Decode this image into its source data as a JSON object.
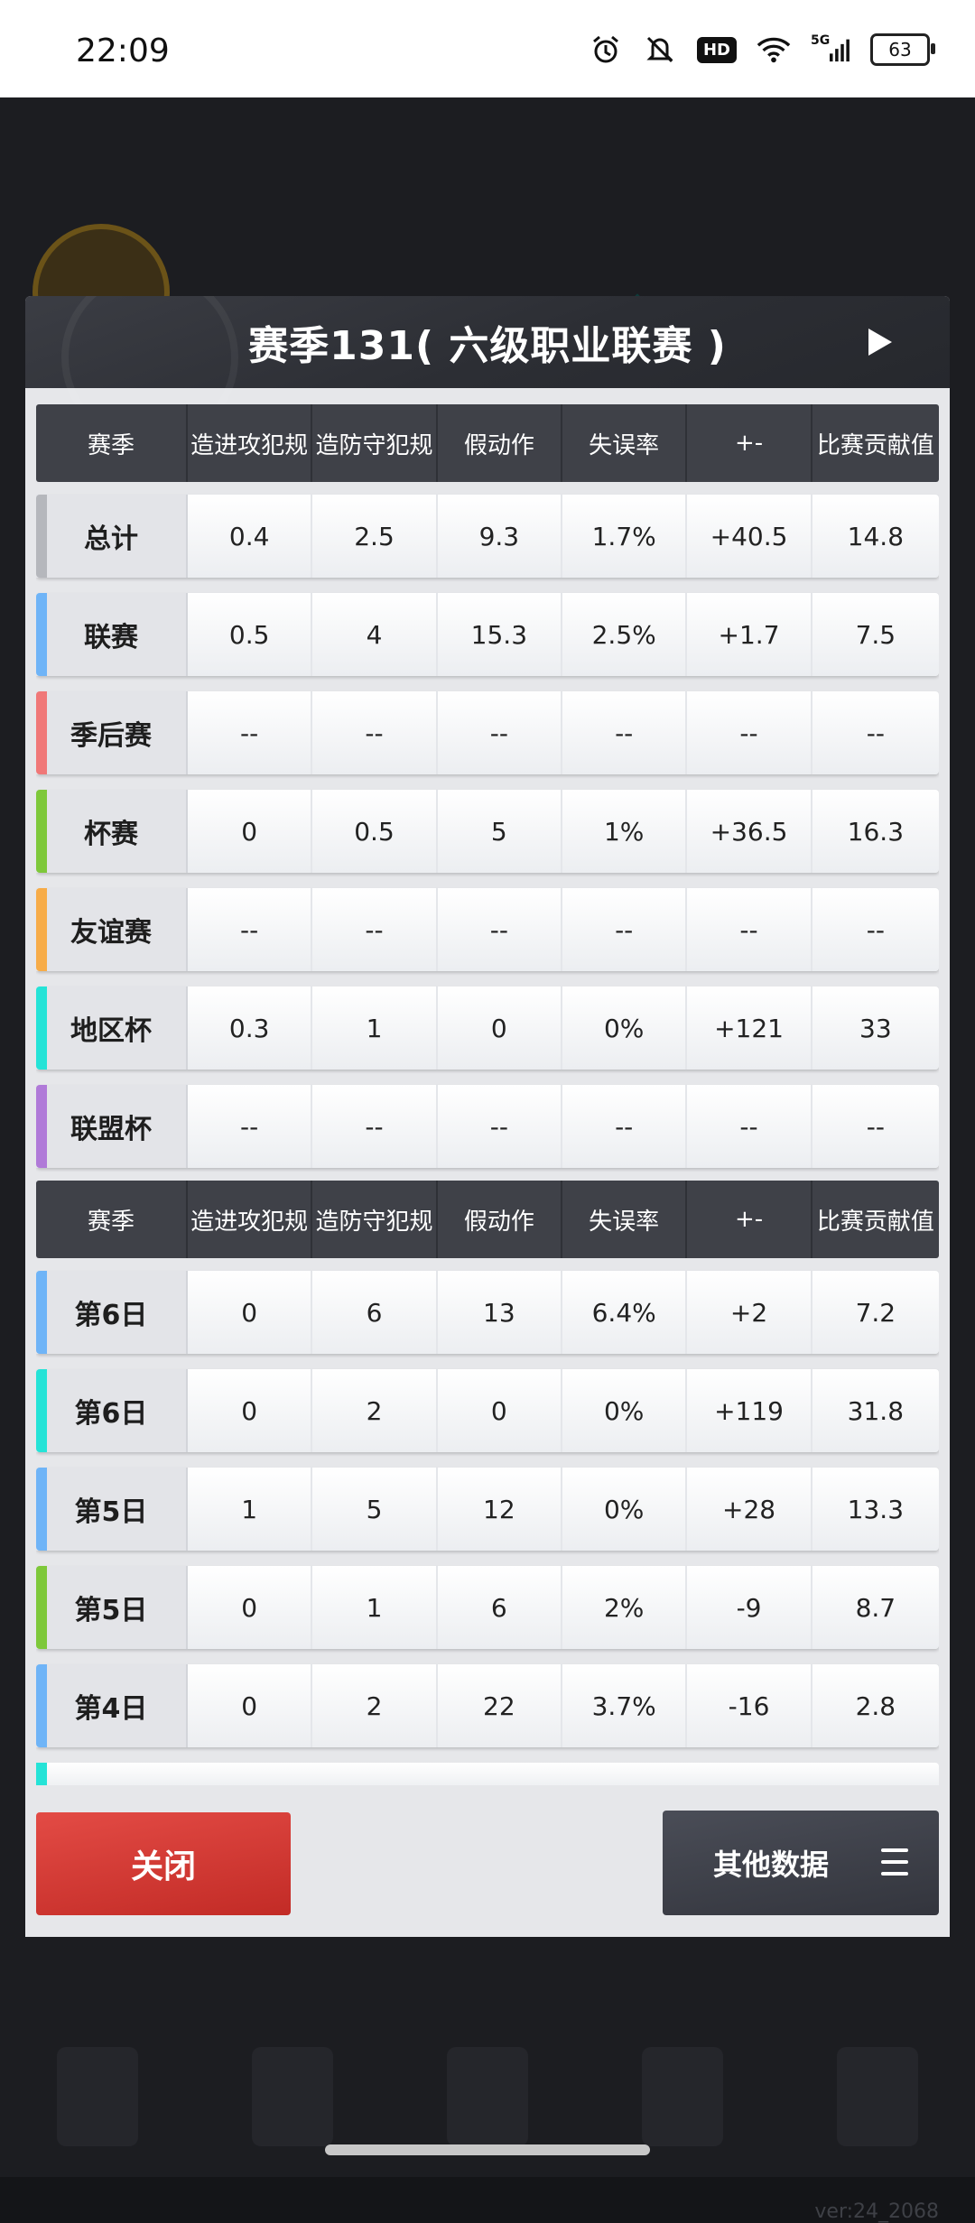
{
  "status_bar": {
    "time": "22:09",
    "hd": "HD",
    "network": "5G",
    "battery": "63"
  },
  "modal": {
    "title": "赛季131( 六级职业联赛 )"
  },
  "table1": {
    "headers": [
      "赛季",
      "造进攻犯规",
      "造防守犯规",
      "假动作",
      "失误率",
      "+-",
      "比赛贡献值"
    ],
    "rows": [
      {
        "label": "总计",
        "color": "#b5b7bc",
        "values": [
          "0.4",
          "2.5",
          "9.3",
          "1.7%",
          "+40.5",
          "14.8"
        ]
      },
      {
        "label": "联赛",
        "color": "#6fb4f7",
        "values": [
          "0.5",
          "4",
          "15.3",
          "2.5%",
          "+1.7",
          "7.5"
        ]
      },
      {
        "label": "季后赛",
        "color": "#f07878",
        "values": [
          "--",
          "--",
          "--",
          "--",
          "--",
          "--"
        ]
      },
      {
        "label": "杯赛",
        "color": "#7ec83a",
        "values": [
          "0",
          "0.5",
          "5",
          "1%",
          "+36.5",
          "16.3"
        ]
      },
      {
        "label": "友谊赛",
        "color": "#f7ac48",
        "values": [
          "--",
          "--",
          "--",
          "--",
          "--",
          "--"
        ]
      },
      {
        "label": "地区杯",
        "color": "#25e3d7",
        "values": [
          "0.3",
          "1",
          "0",
          "0%",
          "+121",
          "33"
        ]
      },
      {
        "label": "联盟杯",
        "color": "#b07ad8",
        "values": [
          "--",
          "--",
          "--",
          "--",
          "--",
          "--"
        ]
      }
    ]
  },
  "table2": {
    "headers": [
      "赛季",
      "造进攻犯规",
      "造防守犯规",
      "假动作",
      "失误率",
      "+-",
      "比赛贡献值"
    ],
    "rows": [
      {
        "label": "第6日",
        "color": "#6fb4f7",
        "values": [
          "0",
          "6",
          "13",
          "6.4%",
          "+2",
          "7.2"
        ]
      },
      {
        "label": "第6日",
        "color": "#25e3d7",
        "values": [
          "0",
          "2",
          "0",
          "0%",
          "+119",
          "31.8"
        ]
      },
      {
        "label": "第5日",
        "color": "#6fb4f7",
        "values": [
          "1",
          "5",
          "12",
          "0%",
          "+28",
          "13.3"
        ]
      },
      {
        "label": "第5日",
        "color": "#7ec83a",
        "values": [
          "0",
          "1",
          "6",
          "2%",
          "-9",
          "8.7"
        ]
      },
      {
        "label": "第4日",
        "color": "#6fb4f7",
        "values": [
          "0",
          "2",
          "22",
          "3.7%",
          "-16",
          "2.8"
        ]
      }
    ]
  },
  "buttons": {
    "close": "关闭",
    "other": "其他数据"
  },
  "background": {
    "version": "ver:24_2068"
  }
}
